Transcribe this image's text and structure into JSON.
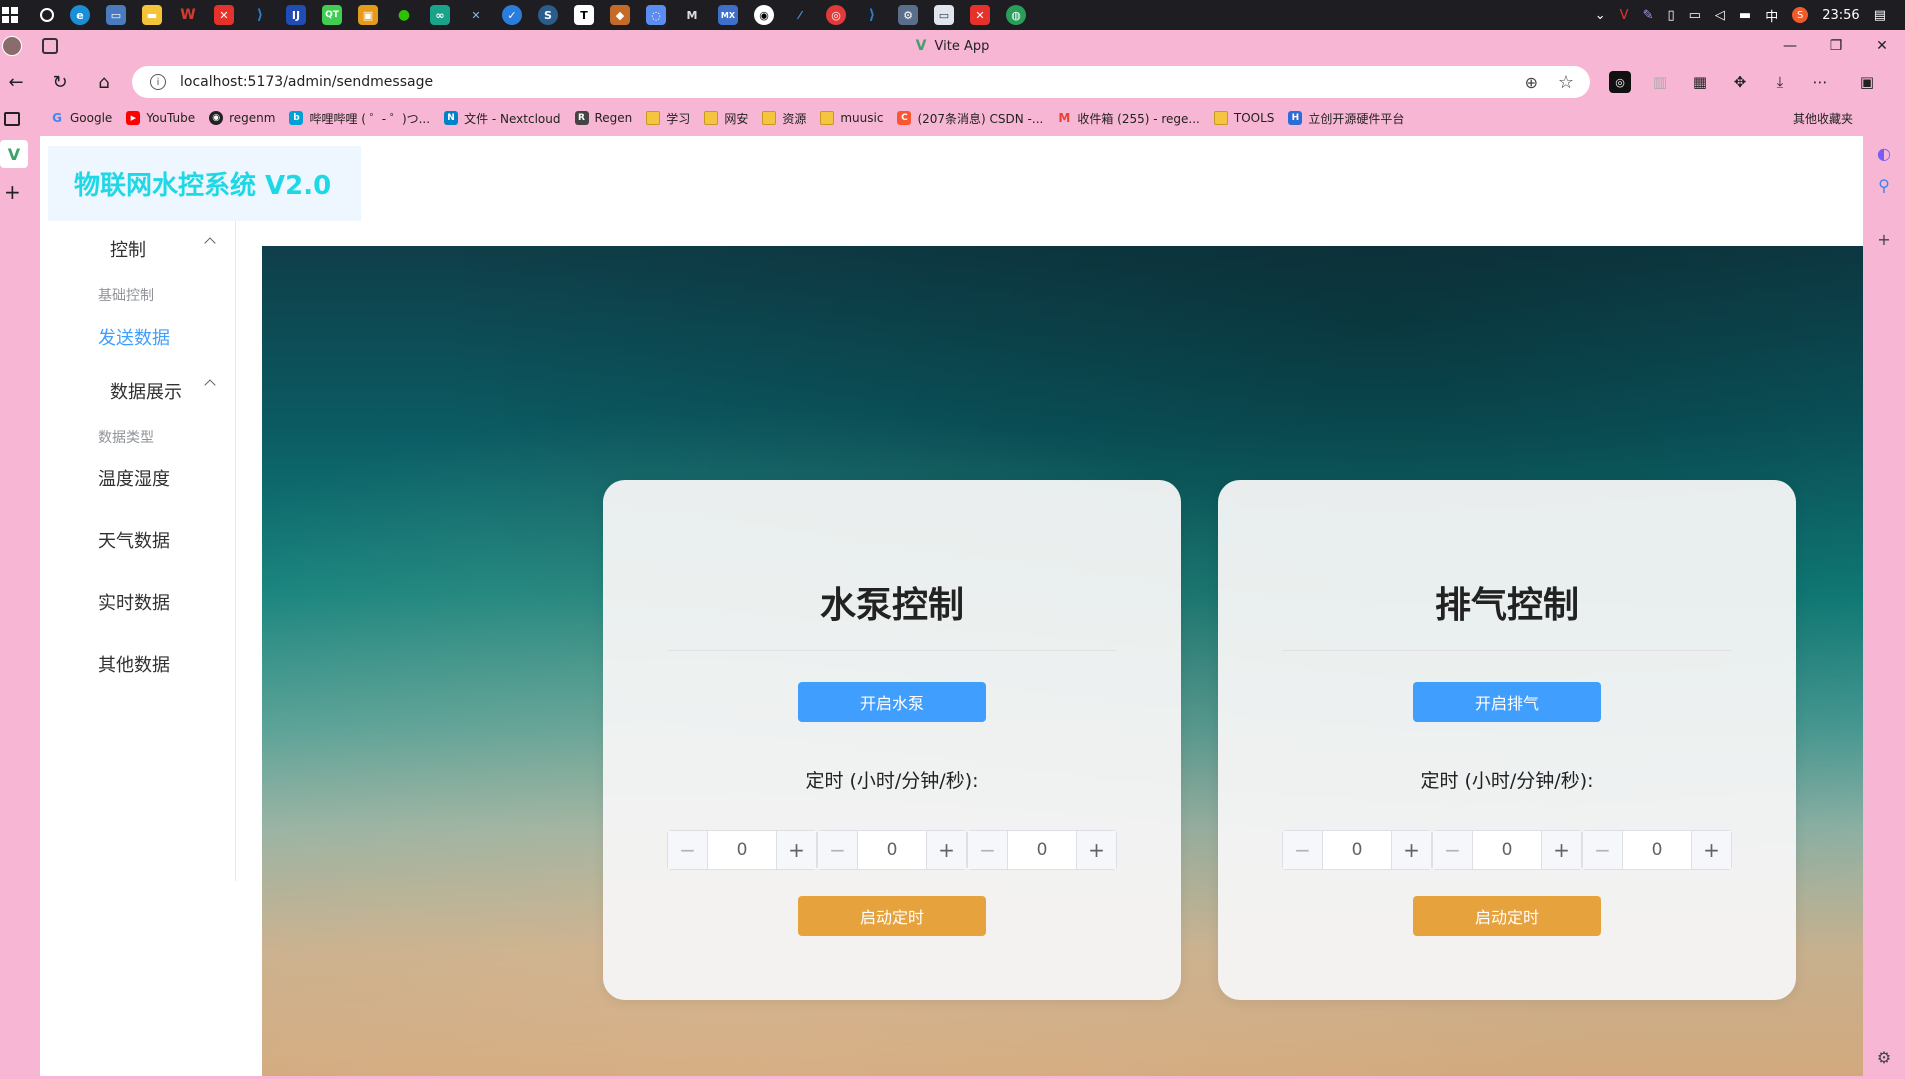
{
  "taskbar": {
    "apps": [
      "search",
      "edge",
      "monitor",
      "folder",
      "wps",
      "x-app",
      "vscode",
      "jetbrains",
      "qt",
      "copy",
      "wechat",
      "app",
      "vpn",
      "cloud",
      "steam",
      "typora",
      "fox",
      "chat",
      "vim",
      "mx",
      "github",
      "dev",
      "netease",
      "vscode2",
      "tools",
      "window",
      "xmind",
      "chrome"
    ],
    "tray_lang": "中",
    "time": "23:56",
    "colors": {
      "wps": "#d73b2e",
      "x-app": "#e5322b",
      "vscode": "#2d7fd3",
      "steam": "#1b2838",
      "wechat": "#2dc100"
    }
  },
  "browser": {
    "tab_title": "Vite App",
    "url": "localhost:5173/admin/sendmessage",
    "bookmarks": [
      {
        "label": "Google",
        "color": "#4285f4",
        "glyph": "G"
      },
      {
        "label": "YouTube",
        "color": "#ff0000",
        "glyph": "▶"
      },
      {
        "label": "regenm",
        "color": "#222222",
        "glyph": "◉"
      },
      {
        "label": "哔哩哔哩 ( ゜- ゜)つ...",
        "color": "#00a1d6",
        "glyph": "b"
      },
      {
        "label": "文件 - Nextcloud",
        "color": "#0082c9",
        "glyph": "N"
      },
      {
        "label": "Regen",
        "color": "#444444",
        "glyph": "R"
      },
      {
        "label": "学习",
        "color": "folder",
        "glyph": ""
      },
      {
        "label": "网安",
        "color": "folder",
        "glyph": ""
      },
      {
        "label": "资源",
        "color": "folder",
        "glyph": ""
      },
      {
        "label": "muusic",
        "color": "folder",
        "glyph": ""
      },
      {
        "label": "(207条消息) CSDN -...",
        "color": "#fc5531",
        "glyph": "C"
      },
      {
        "label": "收件箱 (255) - rege...",
        "color": "#ea4335",
        "glyph": "M"
      },
      {
        "label": "TOOLS",
        "color": "folder",
        "glyph": ""
      },
      {
        "label": "立创开源硬件平台",
        "color": "#2b6cd6",
        "glyph": "H"
      }
    ],
    "other_bookmarks": "其他收藏夹"
  },
  "app": {
    "brand": "物联网水控系统 V2.0",
    "menu": {
      "group1": "控制",
      "group1_sub": "基础控制",
      "group1_item": "发送数据",
      "group2": "数据展示",
      "group2_sub": "数据类型",
      "items": [
        "温度湿度",
        "天气数据",
        "实时数据",
        "其他数据"
      ]
    },
    "cards": [
      {
        "title": "水泵控制",
        "primary_button": "开启水泵",
        "timer_label": "定时 (小时/分钟/秒):",
        "values": [
          "0",
          "0",
          "0"
        ],
        "start_button": "启动定时"
      },
      {
        "title": "排气控制",
        "primary_button": "开启排气",
        "timer_label": "定时 (小时/分钟/秒):",
        "values": [
          "0",
          "0",
          "0"
        ],
        "start_button": "启动定时"
      }
    ],
    "colors": {
      "accent": "#409eff",
      "warning": "#e6a23c",
      "brand_text": "#1fd8e6"
    }
  }
}
